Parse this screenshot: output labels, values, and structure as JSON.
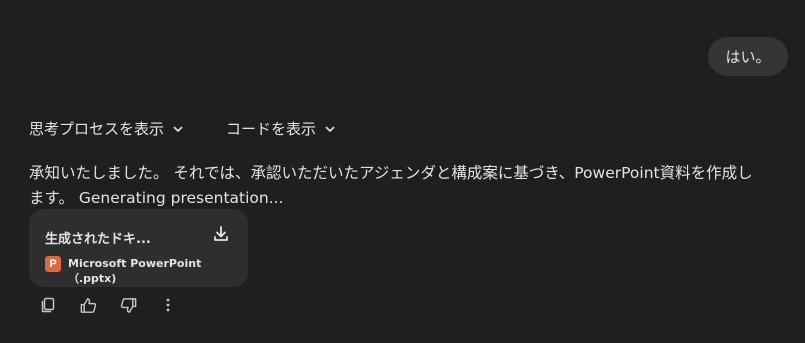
{
  "user_message": {
    "text": "はい。"
  },
  "toggles": {
    "thinking_label": "思考プロセスを表示",
    "code_label": "コードを表示"
  },
  "response": {
    "text": "承知いたしました。 それでは、承認いただいたアジェンダと構成案に基づき、PowerPoint資料を作成します。 Generating presentation..."
  },
  "file_card": {
    "title": "生成されたドキ...",
    "badge": "P",
    "file_type": "Microsoft PowerPoint（.pptx)"
  },
  "colors": {
    "background": "#1f1f20",
    "bubble": "#333537",
    "card": "#2d2e30",
    "ppt_badge": "#e0683f",
    "text": "#e3e3e3"
  },
  "icons": [
    "chevron-down-icon",
    "download-icon",
    "copy-icon",
    "thumbs-up-icon",
    "thumbs-down-icon",
    "more-vert-icon"
  ]
}
